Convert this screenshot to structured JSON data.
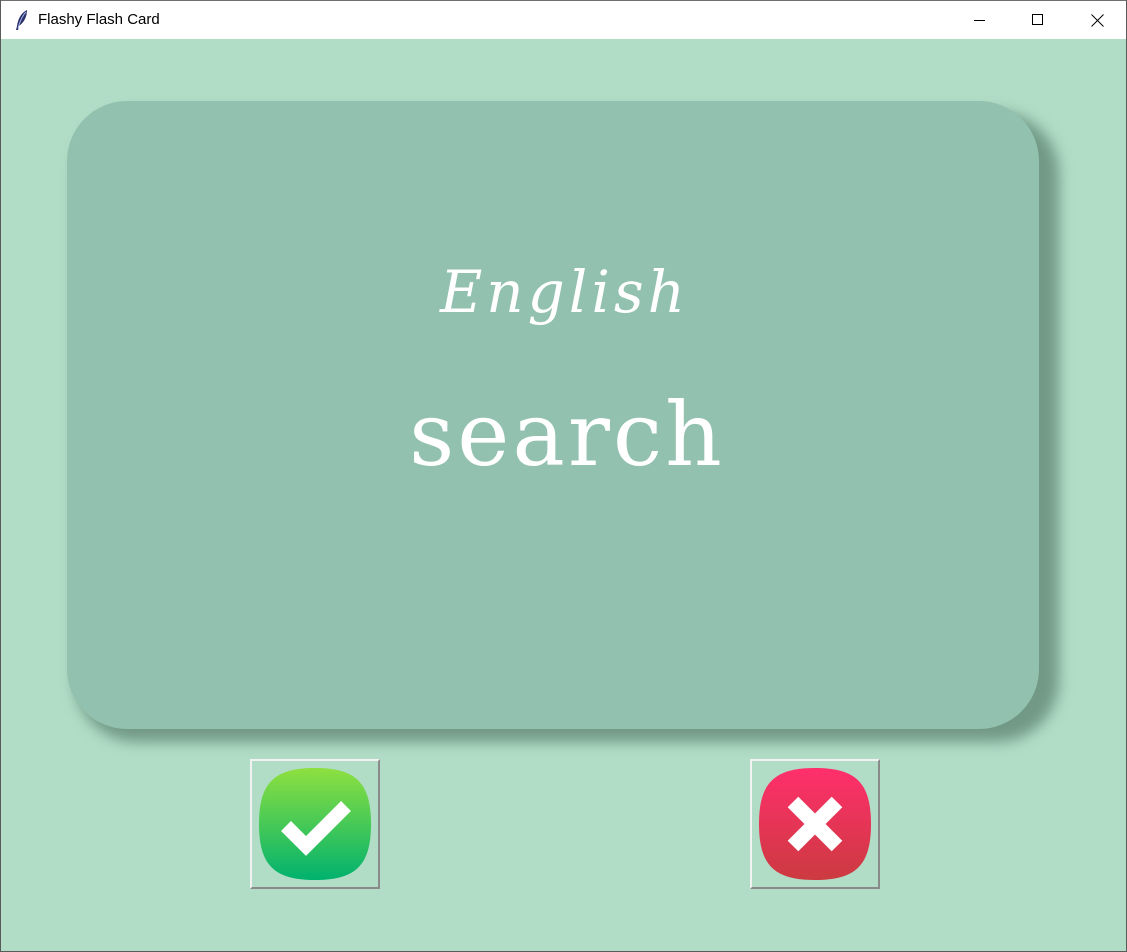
{
  "window": {
    "title": "Flashy Flash Card",
    "icon": "feather-icon",
    "controls": [
      "minimize-icon",
      "maximize-icon",
      "close-icon"
    ]
  },
  "colors": {
    "background": "#b1ddc6",
    "card": "#92c1af",
    "card_text": "#ffffff",
    "right_button_top": "#8ee03f",
    "right_button_bottom": "#00b26e",
    "wrong_button_top": "#ff2f6c",
    "wrong_button_bottom": "#cc3a40"
  },
  "card": {
    "title": "English",
    "word": "search"
  },
  "buttons": {
    "right": {
      "icon": "check-icon"
    },
    "wrong": {
      "icon": "cross-icon"
    }
  }
}
